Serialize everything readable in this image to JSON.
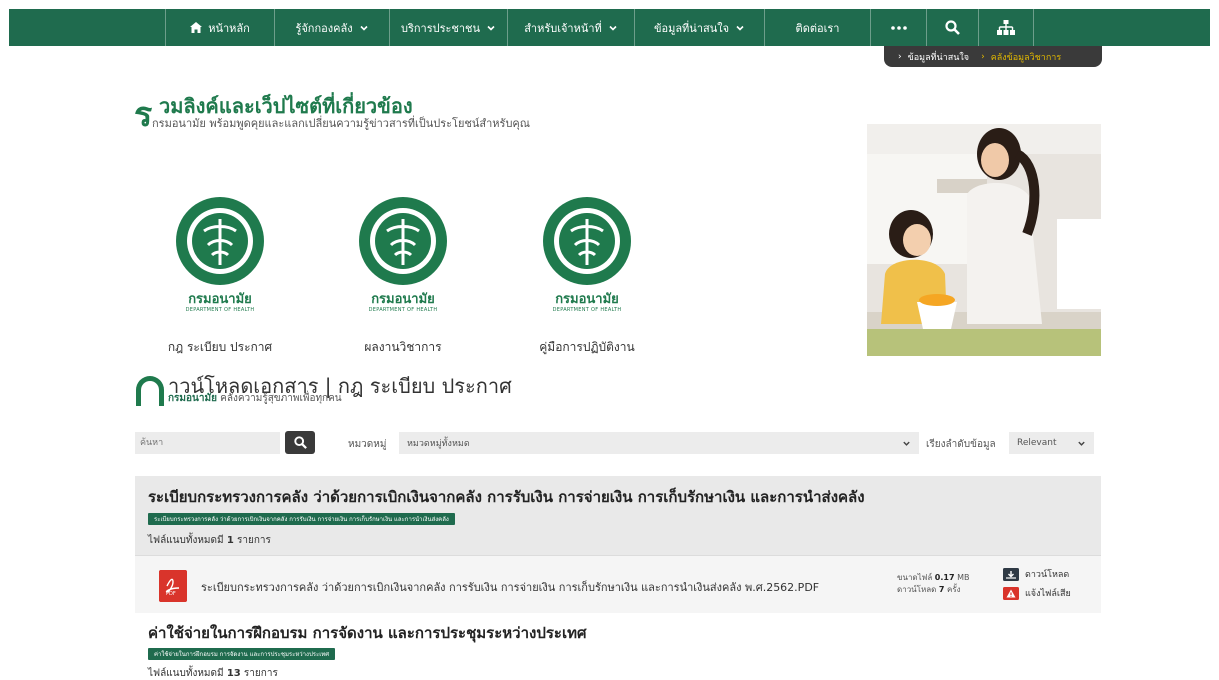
{
  "nav": {
    "items": [
      {
        "label": "หน้าหลัก",
        "icon": "home-icon"
      },
      {
        "label": "รู้จักกองคลัง",
        "dropdown": true
      },
      {
        "label": "บริการประชาชน",
        "dropdown": true
      },
      {
        "label": "สำหรับเจ้าหน้าที่",
        "dropdown": true
      },
      {
        "label": "ข้อมูลที่น่าสนใจ",
        "dropdown": true
      },
      {
        "label": "ติดต่อเรา"
      }
    ],
    "more_icon": "more-icon",
    "search_icon": "search-icon",
    "sitemap_icon": "sitemap-icon",
    "color": "#1f6b4e"
  },
  "breadcrumb": {
    "items": [
      "ข้อมูลที่น่าสนใจ",
      "คลังข้อมูลวิชาการ"
    ]
  },
  "links_section": {
    "title": "วมลิงค์และเว็ปไซต์ที่เกี่ยวข้อง",
    "title_initial": "ร",
    "subtitle": "กรมอนามัย พร้อมพูดคุยและแลกเปลี่ยนความรู้ข่าวสารที่เป็นประโยชน์สำหรับคุณ",
    "cards": [
      {
        "brand": "กรมอนามัย",
        "brand_en": "DEPARTMENT OF HEALTH",
        "caption": "กฎ ระเบียบ ประกาศ"
      },
      {
        "brand": "กรมอนามัย",
        "brand_en": "DEPARTMENT OF HEALTH",
        "caption": "ผลงานวิชาการ"
      },
      {
        "brand": "กรมอนามัย",
        "brand_en": "DEPARTMENT OF HEALTH",
        "caption": "คู่มือการปฏิบัติงาน"
      }
    ]
  },
  "download_section": {
    "title_main": "าวน์โหลดเอกสาร",
    "title_sep": " | ",
    "title_category": "กฎ ระเบียบ ประกาศ",
    "subtitle_brand": "กรมอนามัย",
    "subtitle_rest": "คลังความรู้สุขภาพเพื่อทุกคน"
  },
  "filters": {
    "search_placeholder": "ค้นหา",
    "category_label": "หมวดหมู่",
    "category_value": "หมวดหมู่ทั้งหมด",
    "sort_label": "เรียงลำดับข้อมูล",
    "sort_value": "Relevant"
  },
  "groups": [
    {
      "title": "ระเบียบกระทรวงการคลัง ว่าด้วยการเบิกเงินจากคลัง การรับเงิน การจ่ายเงิน การเก็บรักษาเงิน และการนำส่งคลัง",
      "tag": "ระเบียบกระทรวงการคลัง ว่าด้วยการเบิกเงินจากคลัง การรับเงิน การจ่ายเงิน การเก็บรักษาเงิน และการนำเงินส่งคลัง",
      "count_prefix": "ไฟล์แนบทั้งหมดมี",
      "count_value": "1",
      "count_suffix": "รายการ",
      "files": [
        {
          "name": "ระเบียบกระทรวงการคลัง ว่าด้วยการเบิกเงินจากคลัง การรับเงิน การจ่ายเงิน การเก็บรักษาเงิน และการนำเงินส่งคลัง พ.ศ.2562.PDF",
          "size_label": "ขนาดไฟล์",
          "size_value": "0.17",
          "size_unit": "MB",
          "downloads_label": "ดาวน์โหลด",
          "downloads_value": "7",
          "downloads_unit": "ครั้ง",
          "download_action": "ดาวน์โหลด",
          "report_action": "แจ้งไฟล์เสีย",
          "pdf_label": "PDF"
        }
      ]
    },
    {
      "title": "ค่าใช้จ่ายในการฝึกอบรม การจัดงาน และการประชุมระหว่างประเทศ",
      "tag": "ค่าใช้จ่ายในการฝึกอบรม การจัดงาน และการประชุมระหว่างประเทศ",
      "count_prefix": "ไฟล์แนบทั้งหมดมี",
      "count_value": "13",
      "count_suffix": "รายการ"
    }
  ]
}
